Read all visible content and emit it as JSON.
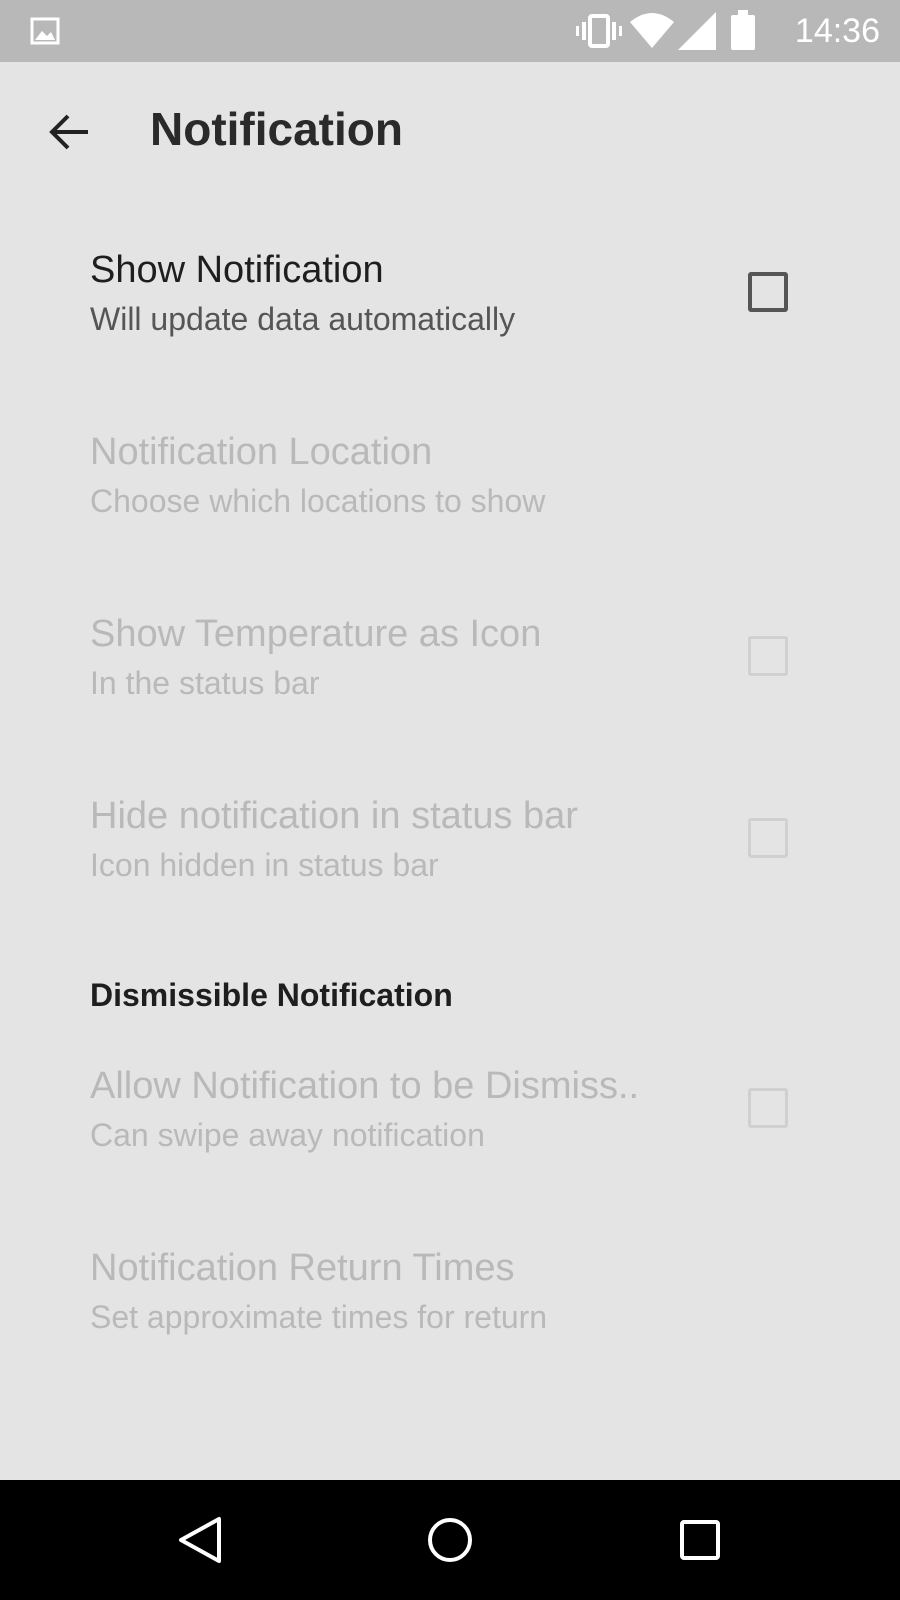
{
  "status_bar": {
    "clock": "14:36",
    "icons": [
      "gallery-icon",
      "vibrate-icon",
      "wifi-icon",
      "signal-icon",
      "battery-icon"
    ],
    "background": "#b8b8b8"
  },
  "app_bar": {
    "title": "Notification",
    "back_icon": "arrow-back-icon"
  },
  "settings": [
    {
      "title": "Show Notification",
      "summary": "Will update data automatically",
      "has_checkbox": true,
      "checked": false,
      "enabled": true
    },
    {
      "title": "Notification Location",
      "summary": "Choose which locations to show",
      "has_checkbox": false,
      "enabled": false
    },
    {
      "title": "Show Temperature as Icon",
      "summary": "In the status bar",
      "has_checkbox": true,
      "checked": false,
      "enabled": false
    },
    {
      "title": "Hide notification in status bar",
      "summary": "Icon hidden in status bar",
      "has_checkbox": true,
      "checked": false,
      "enabled": false
    }
  ],
  "section_header": "Dismissible Notification",
  "dismissible_settings": [
    {
      "title": "Allow Notification to be Dismiss..",
      "summary": "Can swipe away notification",
      "has_checkbox": true,
      "checked": false,
      "enabled": false
    },
    {
      "title": "Notification Return Times",
      "summary": "Set approximate times for return",
      "has_checkbox": false,
      "enabled": false
    }
  ],
  "nav_bar": {
    "buttons": [
      "nav-back-icon",
      "nav-home-icon",
      "nav-recents-icon"
    ],
    "background": "#000000"
  },
  "colors": {
    "background": "#e4e4e4",
    "text_primary": "#1e1e1e",
    "text_secondary": "#555555",
    "text_disabled": "#b9b9b9"
  }
}
